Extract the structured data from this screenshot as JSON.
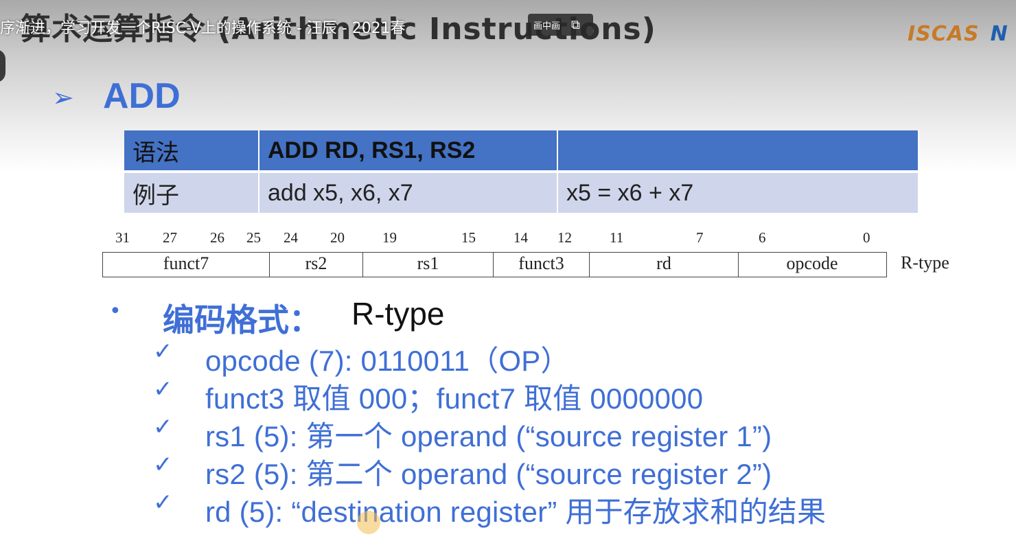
{
  "video": {
    "title": "序渐进，学习开发一个RISC-V上的操作系统 - 汪辰 - 2021春",
    "pip_label": "画中画",
    "logo": "ISCAS",
    "logo_extra": "N"
  },
  "slide": {
    "title": "算术运算指令 (Arithmetic Instructions)",
    "heading": "ADD",
    "syntax_table": {
      "rows": [
        [
          "语法",
          "ADD RD, RS1, RS2",
          ""
        ],
        [
          "例子",
          "add x5, x6, x7",
          "x5 = x6 + x7"
        ]
      ]
    },
    "bit_numbers": [
      "31",
      "27",
      "26",
      "25",
      "24",
      "20",
      "19",
      "15",
      "14",
      "12",
      "11",
      "7",
      "6",
      "0"
    ],
    "fields": [
      "funct7",
      "rs2",
      "rs1",
      "funct3",
      "rd",
      "opcode"
    ],
    "encoding_type": "R-type",
    "format_label": "编码格式：",
    "format_value": "R-type",
    "points": [
      "opcode (7): 0110011（OP）",
      "funct3 取值 000；funct7 取值 0000000",
      "rs1 (5): 第一个 operand (“source register 1”)",
      "rs2 (5): 第二个 operand (“source register 2”)",
      "rd (5): “destination register” 用于存放求和的结果"
    ]
  },
  "colors": {
    "accent_blue": "#3f6fd6",
    "table_header": "#4472c4",
    "table_row": "#cfd5ea"
  }
}
